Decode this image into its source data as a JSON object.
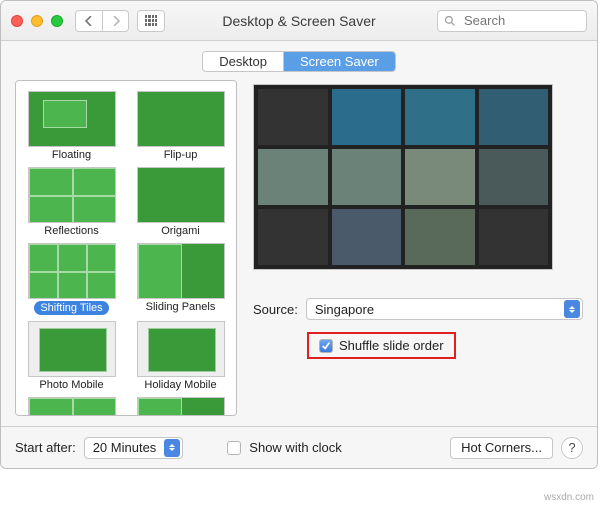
{
  "window": {
    "title": "Desktop & Screen Saver",
    "search_placeholder": "Search"
  },
  "tabs": {
    "desktop": "Desktop",
    "screensaver": "Screen Saver",
    "active": "screensaver"
  },
  "savers": [
    {
      "label": "Floating"
    },
    {
      "label": "Flip-up"
    },
    {
      "label": "Reflections"
    },
    {
      "label": "Origami"
    },
    {
      "label": "Shifting Tiles",
      "selected": true
    },
    {
      "label": "Sliding Panels"
    },
    {
      "label": "Photo Mobile"
    },
    {
      "label": "Holiday Mobile"
    }
  ],
  "source": {
    "label": "Source:",
    "value": "Singapore"
  },
  "shuffle": {
    "label": "Shuffle slide order",
    "checked": true
  },
  "footer": {
    "start_after_label": "Start after:",
    "start_after_value": "20 Minutes",
    "show_with_clock_label": "Show with clock",
    "show_with_clock_checked": false,
    "hot_corners_label": "Hot Corners...",
    "help": "?"
  },
  "watermark": "wsxdn.com"
}
